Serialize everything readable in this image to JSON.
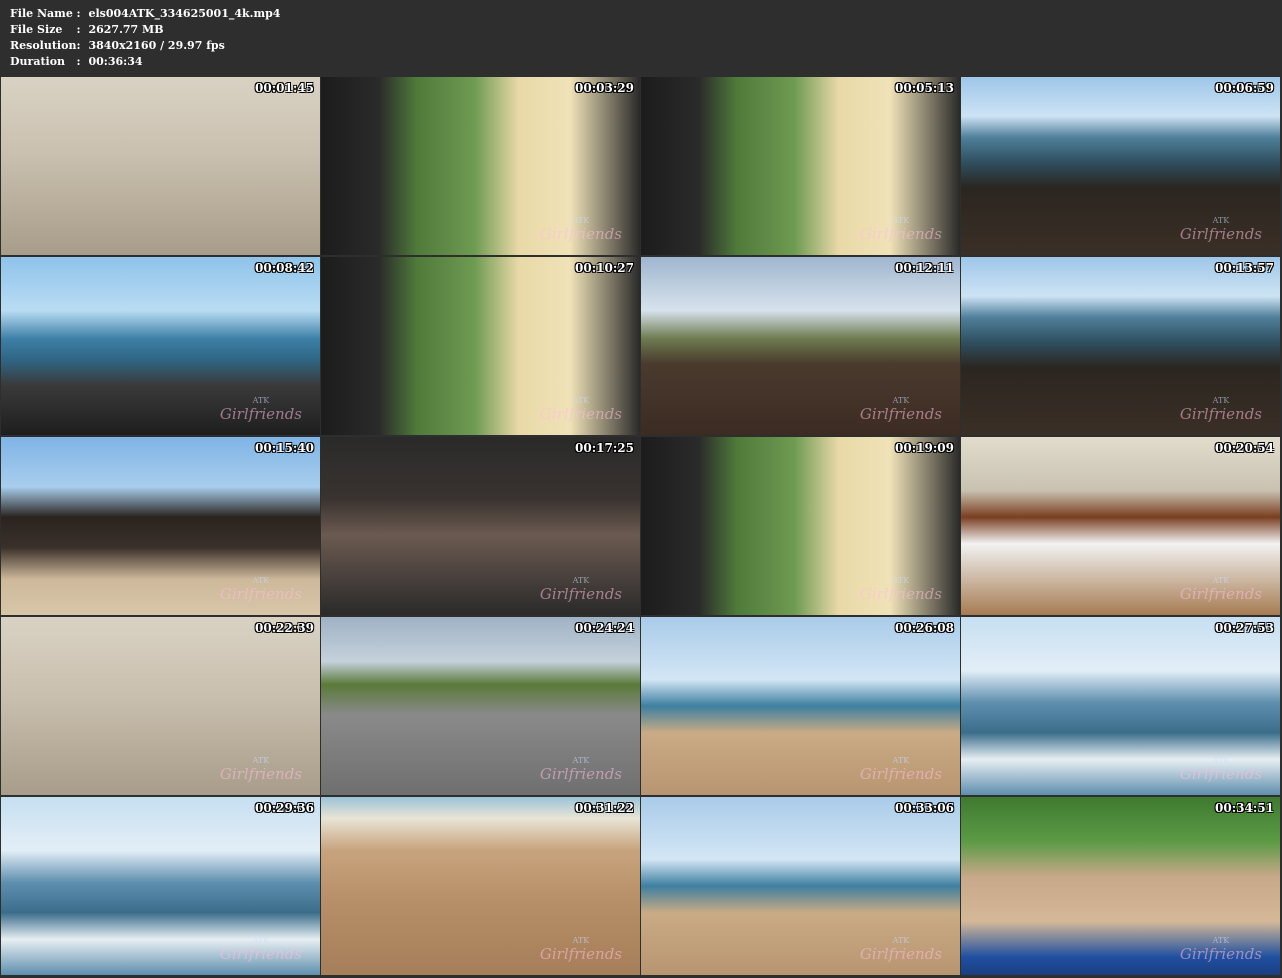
{
  "info": {
    "file_name_label": "File Name",
    "file_name": "els004ATK_334625001_4k.mp4",
    "file_size_label": "File Size",
    "file_size": "2627.77 MB",
    "resolution_label": "Resolution",
    "resolution": "3840x2160 / 29.97 fps",
    "duration_label": "Duration",
    "duration": "00:36:34",
    "separator": ":"
  },
  "thumbnails": [
    {
      "time": "00:01:45",
      "scene": "room"
    },
    {
      "time": "00:03:29",
      "scene": "car-window"
    },
    {
      "time": "00:05:13",
      "scene": "car-window"
    },
    {
      "time": "00:06:59",
      "scene": "rocky-shore"
    },
    {
      "time": "00:08:42",
      "scene": "dashboard-sea"
    },
    {
      "time": "00:10:27",
      "scene": "car-window"
    },
    {
      "time": "00:12:11",
      "scene": "lava-field"
    },
    {
      "time": "00:13:57",
      "scene": "rocky-shore"
    },
    {
      "time": "00:15:40",
      "scene": "beach-rocks"
    },
    {
      "time": "00:17:25",
      "scene": "car-interior"
    },
    {
      "time": "00:19:09",
      "scene": "car-window"
    },
    {
      "time": "00:20:54",
      "scene": "kitchen"
    },
    {
      "time": "00:22:39",
      "scene": "room"
    },
    {
      "time": "00:24:24",
      "scene": "parking-lot"
    },
    {
      "time": "00:26:08",
      "scene": "beach"
    },
    {
      "time": "00:27:53",
      "scene": "ocean-waves"
    },
    {
      "time": "00:29:36",
      "scene": "ocean-waves"
    },
    {
      "time": "00:31:22",
      "scene": "sand"
    },
    {
      "time": "00:33:06",
      "scene": "beach"
    },
    {
      "time": "00:34:51",
      "scene": "beach-grass"
    }
  ],
  "watermark": {
    "brand_small": "ATK",
    "brand": "Girlfriends"
  },
  "colors": {
    "background": "#2e2e2e",
    "text": "#ffffff"
  }
}
